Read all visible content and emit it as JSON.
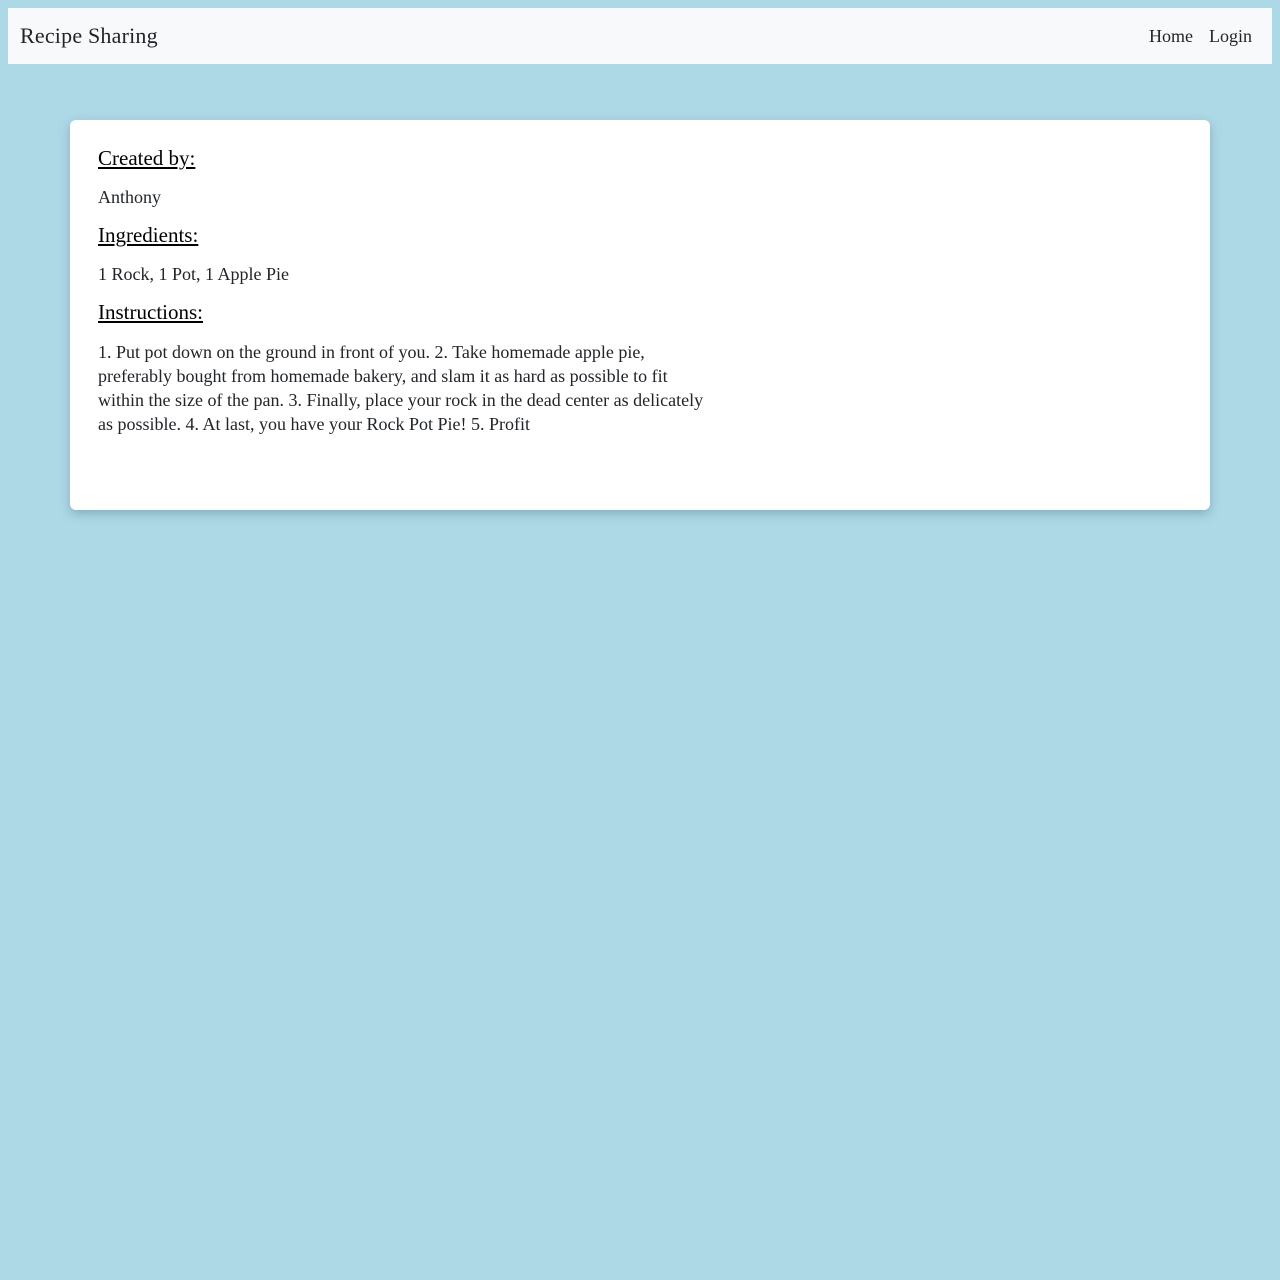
{
  "navbar": {
    "brand": "Recipe Sharing",
    "links": [
      "Home",
      "Login"
    ]
  },
  "recipe": {
    "created_by_heading": "Created by:",
    "author": "Anthony",
    "ingredients_heading": "Ingredients:",
    "ingredients": "1 Rock, 1 Pot, 1 Apple Pie",
    "instructions_heading": "Instructions:",
    "instructions": "1. Put pot down on the ground in front of you. 2. Take homemade apple pie, preferably bought from homemade bakery, and slam it as hard as possible to fit within the size of the pan. 3. Finally, place your rock in the dead center as delicately as possible. 4. At last, you have your Rock Pot Pie! 5. Profit"
  },
  "colors": {
    "background": "#add8e6",
    "navbar": "#f8f9fa",
    "card": "#ffffff"
  }
}
